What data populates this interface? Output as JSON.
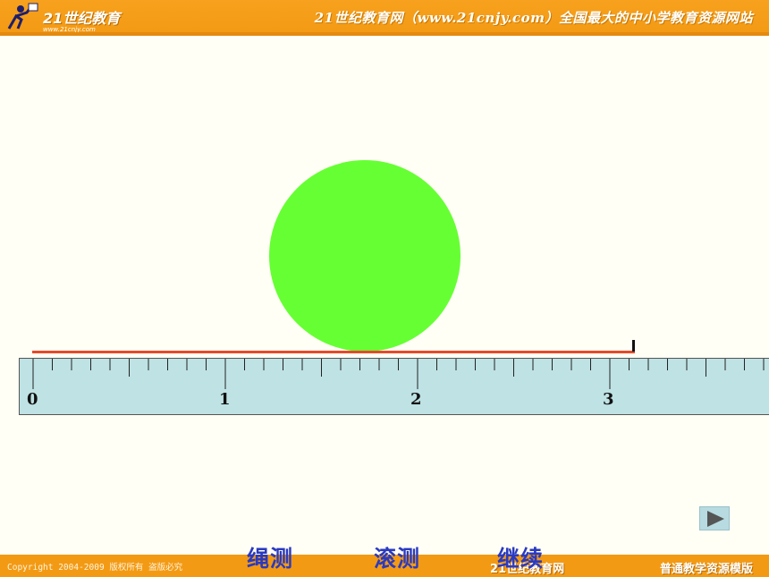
{
  "header": {
    "logo_name": "21世纪教育",
    "logo_url": "www.21cnjy.com",
    "slogan": "21世纪教育网（www.21cnjy.com）全国最大的中小学教育资源网站"
  },
  "scene": {
    "ruler_labels": [
      "0",
      "1",
      "2",
      "3"
    ],
    "circle_color": "#66ff33",
    "rope_color": "#e8492a",
    "ruler_color": "#bfe2e4"
  },
  "controls": {
    "rope_measure": "绳测",
    "roll_measure": "滚测",
    "continue": "继续",
    "next_icon": "play-triangle-icon"
  },
  "footer": {
    "copyright": "Copyright 2004-2009 版权所有 盗版必究",
    "brand": "21世纪教育网",
    "template": "普通教学资源模版"
  }
}
